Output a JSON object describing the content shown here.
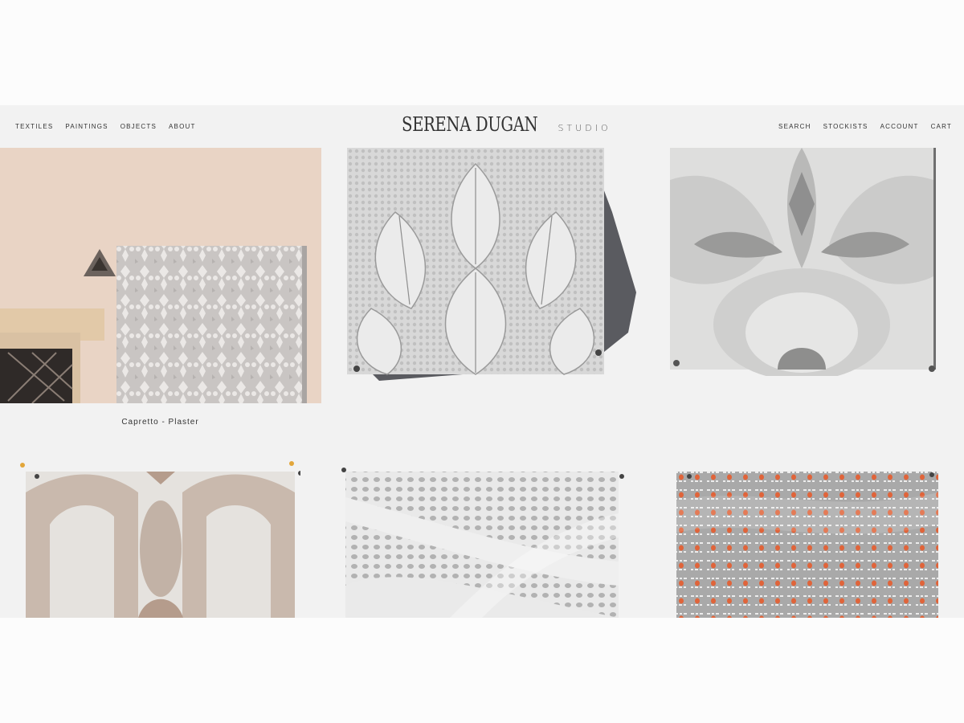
{
  "nav_left": [
    {
      "label": "TEXTILES"
    },
    {
      "label": "PAINTINGS"
    },
    {
      "label": "OBJECTS"
    },
    {
      "label": "ABOUT"
    }
  ],
  "logo": {
    "main": "SERENA DUGAN",
    "sub": "STUDIO"
  },
  "nav_right": [
    {
      "label": "SEARCH"
    },
    {
      "label": "STOCKISTS"
    },
    {
      "label": "ACCOUNT"
    },
    {
      "label": "CART"
    }
  ],
  "products": [
    {
      "caption": "Capretto - Plaster"
    }
  ],
  "colors": {
    "page_bg": "#f2f2f2",
    "outer_bg": "#fcfcfc",
    "text": "#333333",
    "accent_orange": "#e0643a"
  }
}
